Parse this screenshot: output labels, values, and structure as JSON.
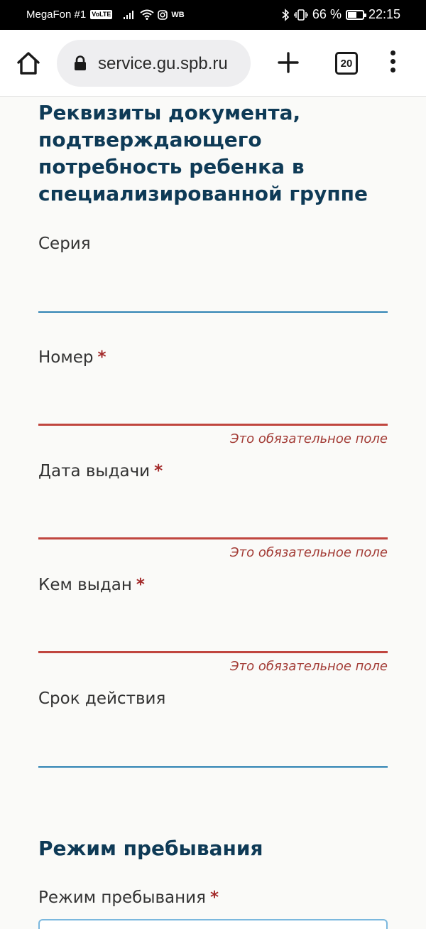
{
  "status_bar": {
    "carrier": "MegaFon #1",
    "volte": "VoLTE",
    "wb": "WB",
    "battery_percent": "66 %",
    "battery_level": 0.66,
    "time": "22:15"
  },
  "browser": {
    "url": "service.gu.spb.ru",
    "tab_count": "20"
  },
  "form": {
    "section1_title": "Реквизиты документа, подтверждающего потребность ребенка в специализированной группе",
    "fields": [
      {
        "label": "Серия",
        "required": false,
        "value": "",
        "error": ""
      },
      {
        "label": "Номер",
        "required": true,
        "value": "",
        "error": "Это обязательное поле"
      },
      {
        "label": "Дата выдачи",
        "required": true,
        "value": "",
        "error": "Это обязательное поле"
      },
      {
        "label": "Кем выдан",
        "required": true,
        "value": "",
        "error": "Это обязательное поле"
      },
      {
        "label": "Срок действия",
        "required": false,
        "value": "",
        "error": ""
      }
    ],
    "required_mark": "*",
    "section2_title": "Режим пребывания",
    "mode_label": "Режим пребывания",
    "mode_required": true
  },
  "colors": {
    "heading": "#0e3a56",
    "line_normal": "#2f83b3",
    "line_error": "#c0463f",
    "error_text": "#a33c36",
    "required_mark": "#a32a2a"
  }
}
